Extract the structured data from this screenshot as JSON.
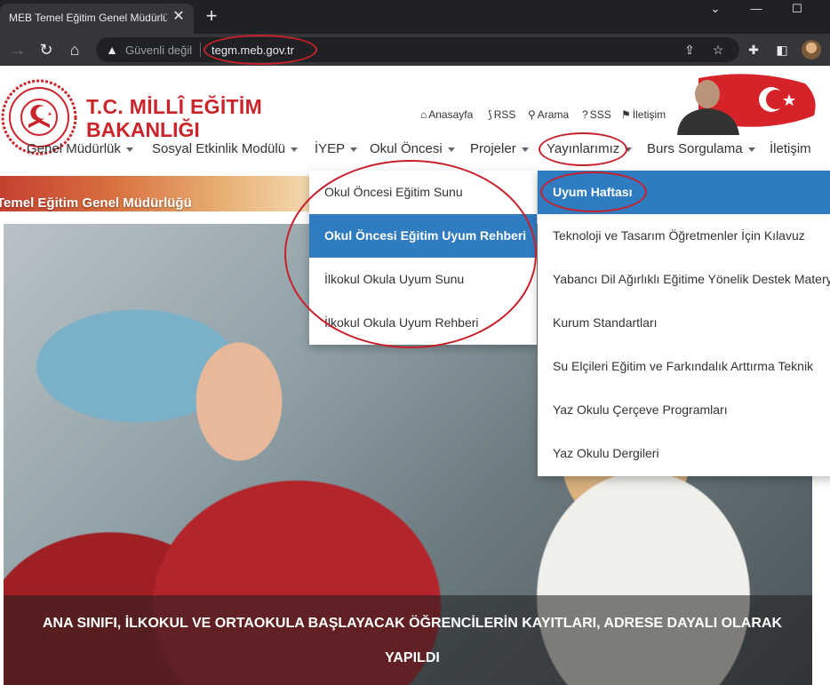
{
  "browser": {
    "tab_title": "MEB Temel Eğitim Genel Müdürlü",
    "tab_close": "✕",
    "new_tab": "+",
    "window_controls": {
      "collapse": "⌄",
      "minimize": "—",
      "maximize": "☐"
    },
    "address": {
      "security_label": "Güvenli değil",
      "url": "tegm.meb.gov.tr"
    }
  },
  "site": {
    "brand": {
      "line1": "T.C. MİLLÎ EĞİTİM",
      "line2": "BAKANLIĞI"
    },
    "quick_links": [
      {
        "label": "Anasayfa",
        "icon": "home-icon"
      },
      {
        "label": "RSS",
        "icon": "rss-icon"
      },
      {
        "label": "Arama",
        "icon": "search-icon"
      },
      {
        "label": "SSS",
        "icon": "question-icon"
      },
      {
        "label": "İletişim",
        "icon": "location-pin-icon"
      }
    ],
    "nav": [
      {
        "label": "Genel Müdürlük"
      },
      {
        "label": "Sosyal Etkinlik Modülü"
      },
      {
        "label": "İYEP"
      },
      {
        "label": "Okul Öncesi"
      },
      {
        "label": "Projeler"
      },
      {
        "label": "Yayınlarımız"
      },
      {
        "label": "Burs Sorgulama"
      },
      {
        "label": "İletişim"
      }
    ],
    "banner_text": "Temel Eğitim Genel Müdürlüğü",
    "dropdown_okul_oncesi": [
      {
        "label": "Okul Öncesi Eğitim Sunu"
      },
      {
        "label": "Okul Öncesi Eğitim Uyum Rehberi"
      },
      {
        "label": "İlkokul Okula Uyum Sunu"
      },
      {
        "label": "İlkokul Okula Uyum Rehberi"
      }
    ],
    "dropdown_yayinlarimiz": [
      {
        "label": "Uyum Haftası"
      },
      {
        "label": "Teknoloji ve Tasarım Öğretmenler İçin Kılavuz"
      },
      {
        "label": "Yabancı Dil Ağırlıklı Eğitime Yönelik Destek Materyalleri"
      },
      {
        "label": "Kurum Standartları"
      },
      {
        "label": "Su Elçileri Eğitim ve Farkındalık Arttırma Teknik"
      },
      {
        "label": "Yaz Okulu Çerçeve Programları"
      },
      {
        "label": "Yaz Okulu Dergileri"
      }
    ],
    "hero_caption": "ANA SINIFI, İLKOKUL VE ORTAOKULA BAŞLAYACAK ÖĞRENCİLERİN KAYITLARI, ADRESE DAYALI OLARAK YAPILDI"
  },
  "colors": {
    "brand_red": "#c9252b",
    "menu_active_blue": "#2f7cc1",
    "annotation_red": "#c8202a"
  }
}
